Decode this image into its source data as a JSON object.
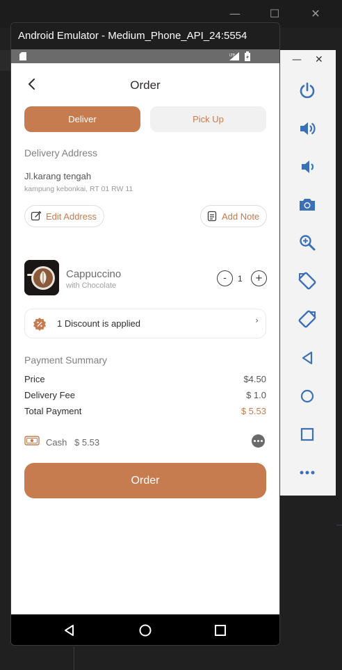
{
  "emulator": {
    "window_title": "Android Emulator - Medium_Phone_API_24:5554"
  },
  "app": {
    "header": {
      "title": "Order"
    },
    "tabs": [
      {
        "label": "Deliver",
        "active": true
      },
      {
        "label": "Pick Up",
        "active": false
      }
    ],
    "delivery": {
      "section_title": "Delivery Address",
      "address_line": "Jl.karang tengah",
      "address_detail": "kampung kebonkai, RT 01 RW 11",
      "edit_label": "Edit Address",
      "note_label": "Add Note"
    },
    "product": {
      "name": "Cappuccino",
      "subtitle": "with Chocolate",
      "quantity": "1",
      "minus": "-",
      "plus": "+"
    },
    "discount": {
      "text": "1 Discount is applied",
      "chevron": "›"
    },
    "payment": {
      "section_title": "Payment Summary",
      "rows": [
        {
          "label": "Price",
          "value": "$4.50"
        },
        {
          "label": "Delivery Fee",
          "value": "$ 1.0"
        },
        {
          "label": "Total Payment",
          "value": "$ 5.53"
        }
      ],
      "method_label": "Cash",
      "method_amount": "$ 5.53"
    },
    "order_button": "Order"
  },
  "colors": {
    "accent": "#c67c4e",
    "dark_text": "#2f2d2c",
    "muted": "#808080"
  },
  "icons": {
    "back": "chevron-left-icon",
    "edit": "edit-icon",
    "note": "note-icon",
    "discount": "discount-badge-icon",
    "cash": "cash-icon",
    "more": "more-dots-icon"
  }
}
